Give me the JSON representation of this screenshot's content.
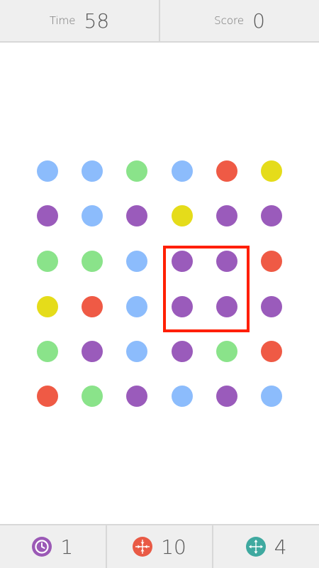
{
  "header": {
    "time_label": "Time",
    "time_value": "58",
    "score_label": "Score",
    "score_value": "0"
  },
  "board": {
    "rows": 6,
    "cols": 6,
    "grid": [
      [
        "blue",
        "blue",
        "green",
        "blue",
        "red",
        "yellow"
      ],
      [
        "purple",
        "blue",
        "purple",
        "yellow",
        "purple",
        "purple"
      ],
      [
        "green",
        "green",
        "blue",
        "purple",
        "purple",
        "red"
      ],
      [
        "yellow",
        "red",
        "blue",
        "purple",
        "purple",
        "purple"
      ],
      [
        "green",
        "purple",
        "blue",
        "purple",
        "green",
        "red"
      ],
      [
        "red",
        "green",
        "purple",
        "blue",
        "purple",
        "blue"
      ]
    ],
    "selection": {
      "rows": [
        2,
        3
      ],
      "cols": [
        3,
        4
      ],
      "color": "#ff1f00"
    }
  },
  "colors": {
    "blue": "#8cbcfc",
    "green": "#8ae38a",
    "red": "#ef5a45",
    "yellow": "#e5dc1a",
    "purple": "#9a5bbb"
  },
  "powerups": [
    {
      "name": "time-stop",
      "icon": "clock-icon",
      "count": "1",
      "color": "#9b59b6"
    },
    {
      "name": "shrinker",
      "icon": "shrinker-icon",
      "count": "10",
      "color": "#e95a45"
    },
    {
      "name": "expander",
      "icon": "expander-icon",
      "count": "4",
      "color": "#3fa9a0"
    }
  ]
}
